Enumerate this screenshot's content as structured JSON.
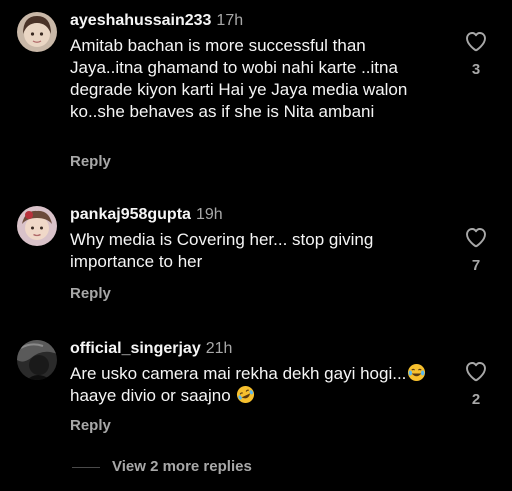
{
  "comments": [
    {
      "username": "ayeshahussain233",
      "time": "17h",
      "text": "Amitab bachan is more successful than Jaya..itna ghamand to wobi nahi karte ..itna degrade kiyon karti Hai ye Jaya media walon ko..she behaves as if she is Nita ambani",
      "reply_label": "Reply",
      "like_count": "3"
    },
    {
      "username": "pankaj958gupta",
      "time": "19h",
      "text": "Why media is Covering her... stop giving importance to her",
      "reply_label": "Reply",
      "like_count": "7"
    },
    {
      "username": "official_singerjay",
      "time": "21h",
      "text_part1": "Are usko camera mai rekha dekh gayi hogi...",
      "emoji1": "face-with-tears-of-joy",
      "text_part2": "haaye divio or saajno ",
      "emoji2": "rolling-on-the-floor-laughing",
      "reply_label": "Reply",
      "like_count": "2"
    }
  ],
  "view_more_replies": "View 2 more replies",
  "colors": {
    "background": "#000000",
    "primary_text": "#f5f5f5",
    "secondary_text": "#a8a8a8",
    "emoji_yellow": "#f7c02e"
  }
}
